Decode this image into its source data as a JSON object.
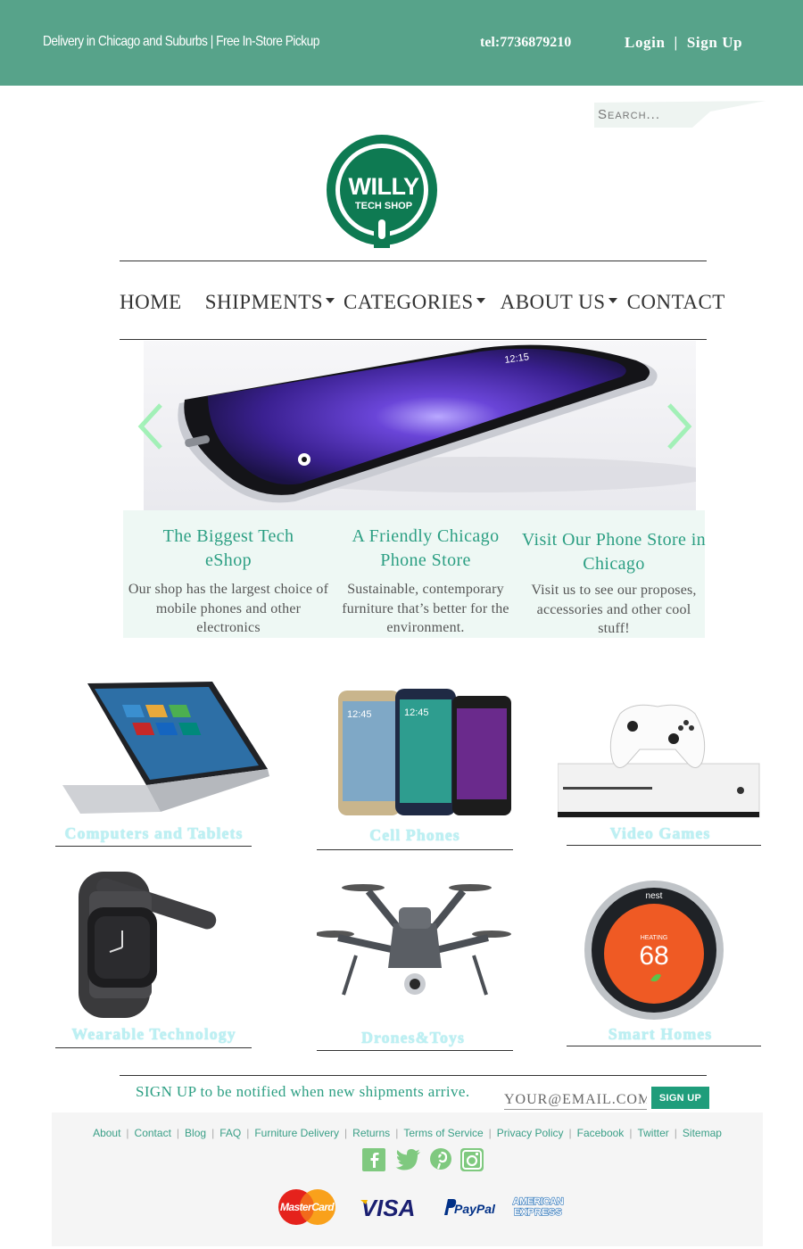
{
  "topbar": {
    "tagline": "Delivery in Chicago and Suburbs | Free In-Store Pickup",
    "phone": "tel:7736879210",
    "login": "Login",
    "separator": "|",
    "signup": "Sign Up"
  },
  "search": {
    "placeholder": "Search..."
  },
  "logo": {
    "line1": "WILLY",
    "line2": "TECH SHOP"
  },
  "nav": {
    "home": "HOME",
    "shipments": "SHIPMENTS",
    "categories": "CATEGORIES",
    "about": "ABOUT US",
    "contact": "CONTACT"
  },
  "hero": {
    "phone_time": "12:15"
  },
  "features": [
    {
      "title": "The Biggest Tech eShop",
      "text": "Our shop has the largest choice of mobile phones and other electronics"
    },
    {
      "title": "A Friendly Chicago Phone Store",
      "text": "Sustainable, contemporary furniture that’s better for the environment."
    },
    {
      "title": "Visit Our Phone Store in Chicago",
      "text": "Visit us to see our proposes, accessories and other cool stuff!"
    }
  ],
  "products": [
    {
      "label": "Computers and Tablets",
      "icon": "laptop-icon"
    },
    {
      "label": "Cell Phones",
      "icon": "phones-icon"
    },
    {
      "label": "Video Games",
      "icon": "console-icon"
    },
    {
      "label": "Wearable Technology",
      "icon": "watch-icon"
    },
    {
      "label": "Drones&Toys",
      "icon": "drone-icon"
    },
    {
      "label": "Smart Homes",
      "icon": "thermostat-icon"
    }
  ],
  "product_images": {
    "phone_time": "12:45",
    "thermostat_brand": "nest",
    "thermostat_mode": "HEATING",
    "thermostat_temp": "68"
  },
  "signup": {
    "text": "SIGN UP to be notified when new shipments arrive.",
    "email_placeholder": "YOUR@EMAIL.COM",
    "button": "SIGN UP"
  },
  "footer": {
    "links": [
      "About",
      "Contact",
      "Blog",
      "FAQ",
      "Furniture Delivery",
      "Returns",
      "Terms of Service",
      "Privacy Policy",
      "Facebook",
      "Twitter",
      "Sitemap"
    ],
    "social": [
      "facebook-icon",
      "twitter-icon",
      "pinterest-icon",
      "instagram-icon"
    ],
    "payments": {
      "mastercard": "MasterCard",
      "visa": "VISA",
      "paypal": "PayPal",
      "amex_line1": "AMERICAN",
      "amex_line2": "EXPRESS"
    }
  },
  "colors": {
    "topbar": "#57a38a",
    "accent": "#2c9f83",
    "feature_bg": "#eef8f4",
    "product_label": "#bdf0f3",
    "button": "#1f9d7b",
    "footer_link": "#3a9f87",
    "logo_green": "#0e7a52"
  }
}
